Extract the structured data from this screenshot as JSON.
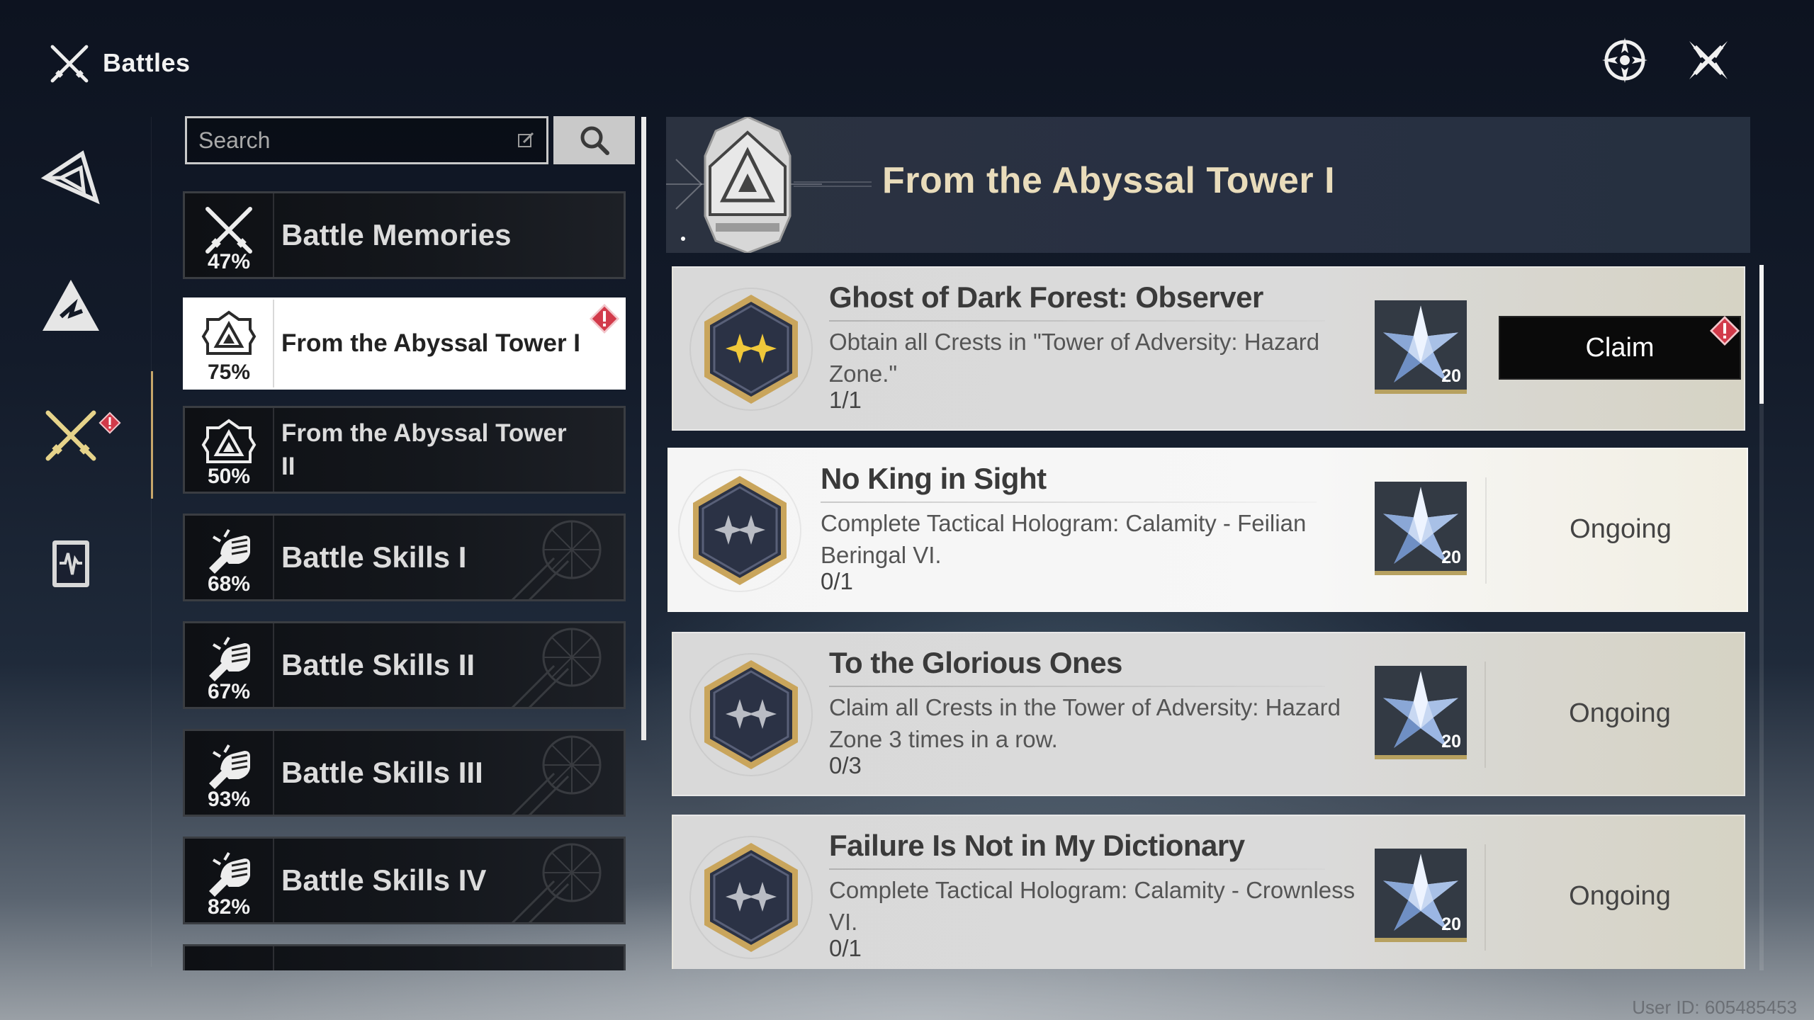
{
  "header": {
    "title": "Battles",
    "logo_icon": "crossed-swords-icon",
    "buttons": [
      {
        "icon": "compass-icon"
      },
      {
        "icon": "close-icon"
      }
    ]
  },
  "rail": {
    "items": [
      {
        "icon": "prism-icon"
      },
      {
        "icon": "mountain-icon"
      },
      {
        "icon": "crossed-swords-icon",
        "active": true,
        "alert": true
      },
      {
        "icon": "codex-icon"
      }
    ]
  },
  "search": {
    "placeholder": "Search"
  },
  "categories": [
    {
      "label": "Battle Memories",
      "percent": "47%"
    },
    {
      "label": "From the Abyssal Tower I",
      "percent": "75%",
      "active": true,
      "alert": true
    },
    {
      "label": "From the Abyssal Tower II",
      "percent": "50%"
    },
    {
      "label": "Battle Skills I",
      "percent": "68%"
    },
    {
      "label": "Battle Skills II",
      "percent": "67%"
    },
    {
      "label": "Battle Skills III",
      "percent": "93%"
    },
    {
      "label": "Battle Skills IV",
      "percent": "82%"
    }
  ],
  "detail": {
    "title": "From the Abyssal Tower I",
    "achievements": [
      {
        "name": "Ghost of Dark Forest: Observer",
        "description": "Obtain all Crests in \"Tower of Adversity: Hazard Zone.\"",
        "progress": "1/1",
        "reward_count": "20",
        "action": "Claim",
        "completed": true
      },
      {
        "name": "No King in Sight",
        "description": "Complete Tactical Hologram: Calamity - Feilian Beringal VI.",
        "progress": "0/1",
        "reward_count": "20",
        "status": "Ongoing"
      },
      {
        "name": "To the Glorious Ones",
        "description": "Claim all Crests in the Tower of Adversity: Hazard Zone 3 times in a row.",
        "progress": "0/3",
        "reward_count": "20",
        "status": "Ongoing"
      },
      {
        "name": "Failure Is Not in My Dictionary",
        "description": "Complete Tactical Hologram: Calamity - Crownless VI.",
        "progress": "0/1",
        "reward_count": "20",
        "status": "Ongoing"
      }
    ]
  },
  "footer": {
    "user_id": "User ID: 605485453"
  },
  "colors": {
    "accent_gold": "#c7a66a",
    "alert_red": "#d23a4a",
    "title_gold": "#e9dcbb"
  }
}
